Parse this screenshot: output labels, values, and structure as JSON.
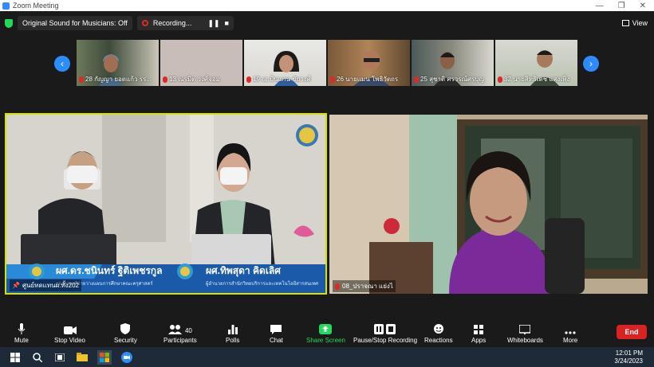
{
  "window": {
    "title": "Zoom Meeting"
  },
  "topbar": {
    "original_sound": "Original Sound for Musicians: Off",
    "recording": "Recording...",
    "view": "View"
  },
  "participants_strip": [
    {
      "name": "28 กัญญา ยอดแก้ว รร..."
    },
    {
      "name": "13 ณรมิต วงศ์จอม"
    },
    {
      "name": "19 เอ.ป้นแกน ขัยวงศ์"
    },
    {
      "name": "26 นายแมน โพธิวัตถร"
    },
    {
      "name": "25 สุชาติ ศรวรณ์ศรบุญ"
    },
    {
      "name": "32 นายสิทธิเดช แสงเพิ่ง"
    }
  ],
  "main_video": {
    "name": "ศูนย์ทดแทนผ.ทั้ง202",
    "caption_left": "ผศ.ดร.ชนินทร์ ฐิติเพชรกูล",
    "caption_left_sub": "รองคณบดีฝ่ายวางแผนการศึกษาคณะครุศาสตร์",
    "caption_right": "ผศ.ทิพสุดา คิดเลิศ",
    "caption_right_sub": "ผู้อำนวยการสำนักวิทยบริการและเทคโนโลยีสารสนเทศ"
  },
  "right_video": {
    "name": "08_ปราจณา แย่งไ"
  },
  "toolbar": {
    "mute": "Mute",
    "stop_video": "Stop Video",
    "security": "Security",
    "participants": "Participants",
    "participants_count": "40",
    "polls": "Polls",
    "chat": "Chat",
    "share_screen": "Share Screen",
    "pause_stop_recording": "Pause/Stop Recording",
    "reactions": "Reactions",
    "apps": "Apps",
    "whiteboards": "Whiteboards",
    "more": "More",
    "end": "End"
  },
  "taskbar": {
    "time": "12:01 PM",
    "date": "3/24/2023"
  },
  "colors": {
    "accent": "#2d8cff",
    "end": "#d92222",
    "share": "#23d959",
    "speaker_border": "#d4e200"
  }
}
